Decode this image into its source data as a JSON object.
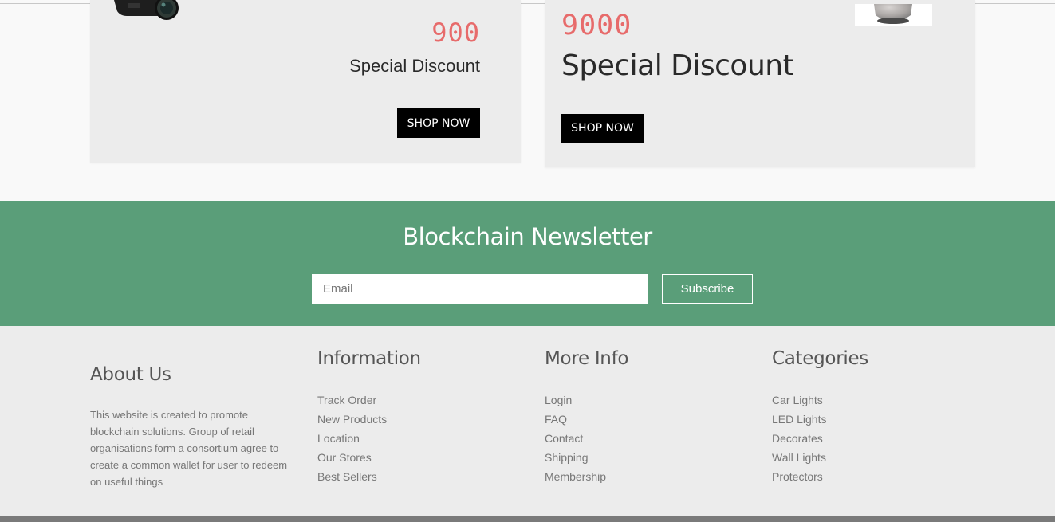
{
  "promo_left": {
    "price": "900",
    "discount": "Special Discount",
    "button": "SHOP NOW"
  },
  "promo_right": {
    "price": "9000",
    "discount": "Special Discount",
    "button": "SHOP NOW"
  },
  "newsletter": {
    "title": "Blockchain Newsletter",
    "email_placeholder": "Email",
    "subscribe": "Subscribe"
  },
  "footer": {
    "about": {
      "title": "About Us",
      "text": "This website is created to promote blockchain solutions. Group of retail organisations form a consortium agree to create a common wallet for user to redeem on useful things"
    },
    "information": {
      "title": "Information",
      "links": [
        "Track Order",
        "New Products",
        "Location",
        "Our Stores",
        "Best Sellers"
      ]
    },
    "more_info": {
      "title": "More Info",
      "links": [
        "Login",
        "FAQ",
        "Contact",
        "Shipping",
        "Membership"
      ]
    },
    "categories": {
      "title": "Categories",
      "links": [
        "Car Lights",
        "LED Lights",
        "Decorates",
        "Wall Lights",
        "Protectors"
      ]
    }
  },
  "colors": {
    "price": "#e76b6b",
    "newsletter_bg": "#5a9e79",
    "footer_bg": "#ececec",
    "button_bg": "#000000"
  },
  "icons": {
    "camera": "camera-image",
    "speaker": "speaker-image"
  }
}
